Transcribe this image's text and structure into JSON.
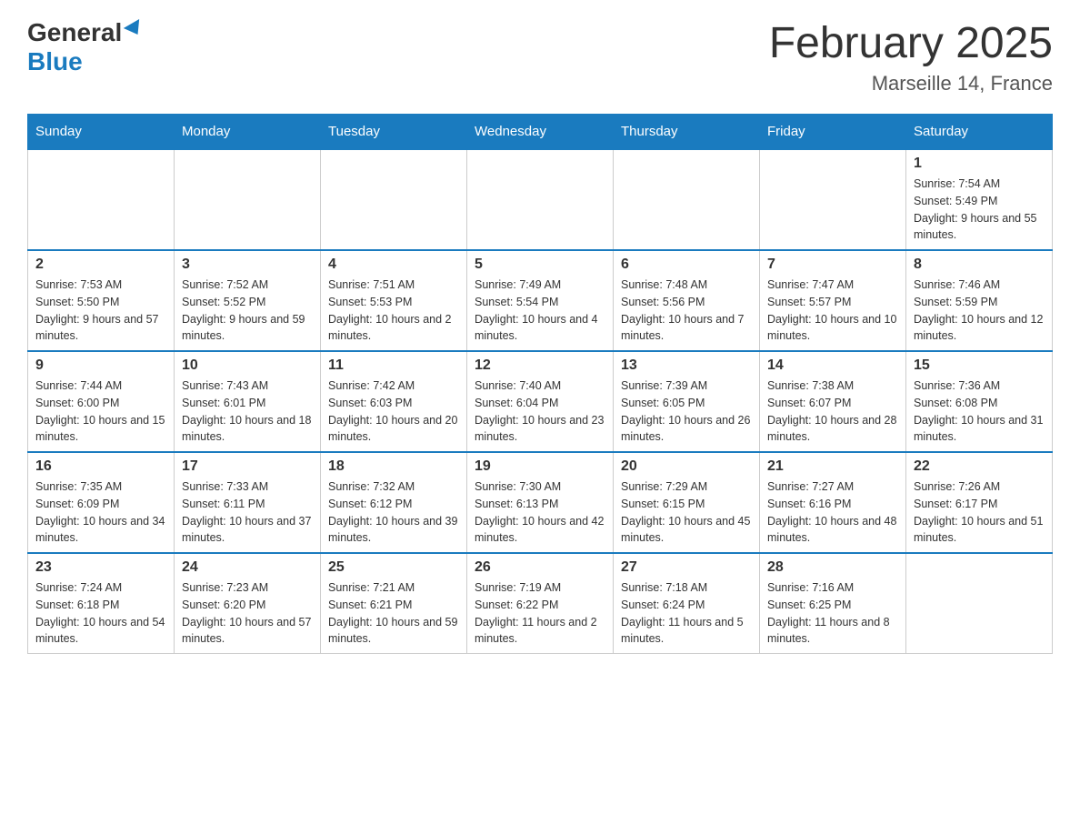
{
  "header": {
    "logo_general": "General",
    "logo_blue": "Blue",
    "month_title": "February 2025",
    "location": "Marseille 14, France"
  },
  "weekdays": [
    "Sunday",
    "Monday",
    "Tuesday",
    "Wednesday",
    "Thursday",
    "Friday",
    "Saturday"
  ],
  "weeks": [
    [
      {
        "day": "",
        "info": ""
      },
      {
        "day": "",
        "info": ""
      },
      {
        "day": "",
        "info": ""
      },
      {
        "day": "",
        "info": ""
      },
      {
        "day": "",
        "info": ""
      },
      {
        "day": "",
        "info": ""
      },
      {
        "day": "1",
        "info": "Sunrise: 7:54 AM\nSunset: 5:49 PM\nDaylight: 9 hours and 55 minutes."
      }
    ],
    [
      {
        "day": "2",
        "info": "Sunrise: 7:53 AM\nSunset: 5:50 PM\nDaylight: 9 hours and 57 minutes."
      },
      {
        "day": "3",
        "info": "Sunrise: 7:52 AM\nSunset: 5:52 PM\nDaylight: 9 hours and 59 minutes."
      },
      {
        "day": "4",
        "info": "Sunrise: 7:51 AM\nSunset: 5:53 PM\nDaylight: 10 hours and 2 minutes."
      },
      {
        "day": "5",
        "info": "Sunrise: 7:49 AM\nSunset: 5:54 PM\nDaylight: 10 hours and 4 minutes."
      },
      {
        "day": "6",
        "info": "Sunrise: 7:48 AM\nSunset: 5:56 PM\nDaylight: 10 hours and 7 minutes."
      },
      {
        "day": "7",
        "info": "Sunrise: 7:47 AM\nSunset: 5:57 PM\nDaylight: 10 hours and 10 minutes."
      },
      {
        "day": "8",
        "info": "Sunrise: 7:46 AM\nSunset: 5:59 PM\nDaylight: 10 hours and 12 minutes."
      }
    ],
    [
      {
        "day": "9",
        "info": "Sunrise: 7:44 AM\nSunset: 6:00 PM\nDaylight: 10 hours and 15 minutes."
      },
      {
        "day": "10",
        "info": "Sunrise: 7:43 AM\nSunset: 6:01 PM\nDaylight: 10 hours and 18 minutes."
      },
      {
        "day": "11",
        "info": "Sunrise: 7:42 AM\nSunset: 6:03 PM\nDaylight: 10 hours and 20 minutes."
      },
      {
        "day": "12",
        "info": "Sunrise: 7:40 AM\nSunset: 6:04 PM\nDaylight: 10 hours and 23 minutes."
      },
      {
        "day": "13",
        "info": "Sunrise: 7:39 AM\nSunset: 6:05 PM\nDaylight: 10 hours and 26 minutes."
      },
      {
        "day": "14",
        "info": "Sunrise: 7:38 AM\nSunset: 6:07 PM\nDaylight: 10 hours and 28 minutes."
      },
      {
        "day": "15",
        "info": "Sunrise: 7:36 AM\nSunset: 6:08 PM\nDaylight: 10 hours and 31 minutes."
      }
    ],
    [
      {
        "day": "16",
        "info": "Sunrise: 7:35 AM\nSunset: 6:09 PM\nDaylight: 10 hours and 34 minutes."
      },
      {
        "day": "17",
        "info": "Sunrise: 7:33 AM\nSunset: 6:11 PM\nDaylight: 10 hours and 37 minutes."
      },
      {
        "day": "18",
        "info": "Sunrise: 7:32 AM\nSunset: 6:12 PM\nDaylight: 10 hours and 39 minutes."
      },
      {
        "day": "19",
        "info": "Sunrise: 7:30 AM\nSunset: 6:13 PM\nDaylight: 10 hours and 42 minutes."
      },
      {
        "day": "20",
        "info": "Sunrise: 7:29 AM\nSunset: 6:15 PM\nDaylight: 10 hours and 45 minutes."
      },
      {
        "day": "21",
        "info": "Sunrise: 7:27 AM\nSunset: 6:16 PM\nDaylight: 10 hours and 48 minutes."
      },
      {
        "day": "22",
        "info": "Sunrise: 7:26 AM\nSunset: 6:17 PM\nDaylight: 10 hours and 51 minutes."
      }
    ],
    [
      {
        "day": "23",
        "info": "Sunrise: 7:24 AM\nSunset: 6:18 PM\nDaylight: 10 hours and 54 minutes."
      },
      {
        "day": "24",
        "info": "Sunrise: 7:23 AM\nSunset: 6:20 PM\nDaylight: 10 hours and 57 minutes."
      },
      {
        "day": "25",
        "info": "Sunrise: 7:21 AM\nSunset: 6:21 PM\nDaylight: 10 hours and 59 minutes."
      },
      {
        "day": "26",
        "info": "Sunrise: 7:19 AM\nSunset: 6:22 PM\nDaylight: 11 hours and 2 minutes."
      },
      {
        "day": "27",
        "info": "Sunrise: 7:18 AM\nSunset: 6:24 PM\nDaylight: 11 hours and 5 minutes."
      },
      {
        "day": "28",
        "info": "Sunrise: 7:16 AM\nSunset: 6:25 PM\nDaylight: 11 hours and 8 minutes."
      },
      {
        "day": "",
        "info": ""
      }
    ]
  ]
}
